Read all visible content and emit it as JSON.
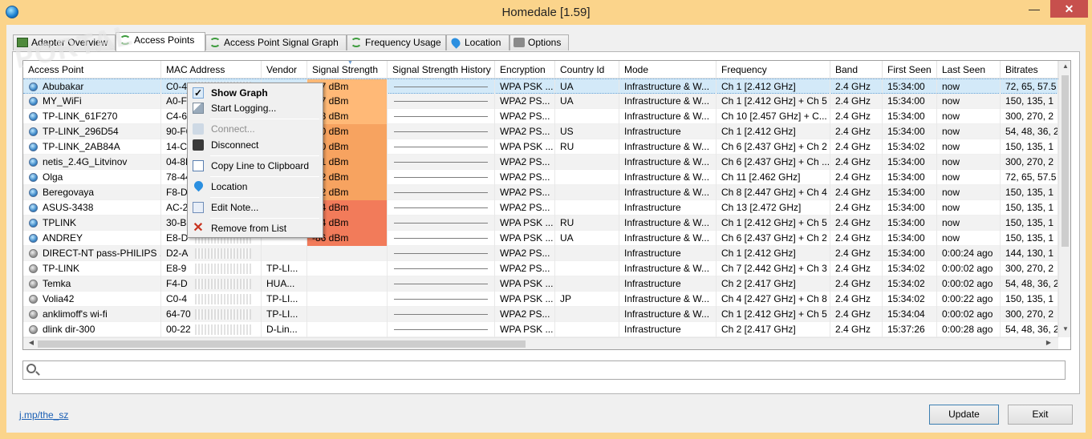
{
  "window": {
    "title": "Homedale [1.59]",
    "minimize": "—",
    "close": "✕"
  },
  "tabs": [
    {
      "label": "Adapter Overview",
      "icon": "adapter-icon"
    },
    {
      "label": "Access Points",
      "icon": "wifi-icon",
      "active": true
    },
    {
      "label": "Access Point Signal Graph",
      "icon": "wifi-icon"
    },
    {
      "label": "Frequency Usage",
      "icon": "wifi-icon"
    },
    {
      "label": "Location",
      "icon": "location-pin-icon"
    },
    {
      "label": "Options",
      "icon": "options-icon"
    }
  ],
  "columns": [
    "Access Point",
    "MAC Address",
    "Vendor",
    "Signal Strength",
    "Signal Strength History",
    "Encryption",
    "Country Id",
    "Mode",
    "Frequency",
    "Band",
    "First Seen",
    "Last Seen",
    "Bitrates"
  ],
  "rows": [
    {
      "ap": "Abubakar",
      "mac": "C0-4",
      "vendor": "",
      "signal": "-77 dBm",
      "enc": "WPA PSK ...",
      "country": "UA",
      "mode": "Infrastructure & W...",
      "freq": "Ch 1 [2.412 GHz]",
      "band": "2.4 GHz",
      "first": "15:34:00",
      "last": "now",
      "bitrates": "72, 65, 57.5"
    },
    {
      "ap": "MY_WiFi",
      "mac": "A0-F",
      "vendor": "",
      "signal": "-77 dBm",
      "enc": "WPA2 PS...",
      "country": "UA",
      "mode": "Infrastructure & W...",
      "freq": "Ch 1 [2.412 GHz] + Ch 5",
      "band": "2.4 GHz",
      "first": "15:34:00",
      "last": "now",
      "bitrates": "150, 135, 1"
    },
    {
      "ap": "TP-LINK_61F270",
      "mac": "C4-6",
      "vendor": "",
      "signal": "-78 dBm",
      "enc": "WPA2 PS...",
      "country": "",
      "mode": "Infrastructure & W...",
      "freq": "Ch 10 [2.457 GHz] + C...",
      "band": "2.4 GHz",
      "first": "15:34:00",
      "last": "now",
      "bitrates": "300, 270, 2"
    },
    {
      "ap": "TP-LINK_296D54",
      "mac": "90-F6",
      "vendor": "",
      "signal": "-80 dBm",
      "enc": "WPA2 PS...",
      "country": "US",
      "mode": "Infrastructure",
      "freq": "Ch 1 [2.412 GHz]",
      "band": "2.4 GHz",
      "first": "15:34:00",
      "last": "now",
      "bitrates": "54, 48, 36, 2"
    },
    {
      "ap": "TP-LINK_2AB84A",
      "mac": "14-C",
      "vendor": "",
      "signal": "-80 dBm",
      "enc": "WPA PSK ...",
      "country": "RU",
      "mode": "Infrastructure & W...",
      "freq": "Ch 6 [2.437 GHz] + Ch 2",
      "band": "2.4 GHz",
      "first": "15:34:02",
      "last": "now",
      "bitrates": "150, 135, 1"
    },
    {
      "ap": "netis_2.4G_Litvinov",
      "mac": "04-8D",
      "vendor": "",
      "signal": "-81 dBm",
      "enc": "WPA2 PS...",
      "country": "",
      "mode": "Infrastructure & W...",
      "freq": "Ch 6 [2.437 GHz] + Ch ...",
      "band": "2.4 GHz",
      "first": "15:34:00",
      "last": "now",
      "bitrates": "300, 270, 2"
    },
    {
      "ap": "Olga",
      "mac": "78-44",
      "vendor": "",
      "signal": "-82 dBm",
      "enc": "WPA2 PS...",
      "country": "",
      "mode": "Infrastructure & W...",
      "freq": "Ch 11 [2.462 GHz]",
      "band": "2.4 GHz",
      "first": "15:34:00",
      "last": "now",
      "bitrates": "72, 65, 57.5"
    },
    {
      "ap": "Beregovaya",
      "mac": "F8-D",
      "vendor": "",
      "signal": "-82 dBm",
      "enc": "WPA2 PS...",
      "country": "",
      "mode": "Infrastructure & W...",
      "freq": "Ch 8 [2.447 GHz] + Ch 4",
      "band": "2.4 GHz",
      "first": "15:34:00",
      "last": "now",
      "bitrates": "150, 135, 1"
    },
    {
      "ap": "ASUS-3438",
      "mac": "AC-2",
      "vendor": "",
      "signal": "-84 dBm",
      "enc": "WPA2 PS...",
      "country": "",
      "mode": "Infrastructure",
      "freq": "Ch 13 [2.472 GHz]",
      "band": "2.4 GHz",
      "first": "15:34:00",
      "last": "now",
      "bitrates": "150, 135, 1"
    },
    {
      "ap": "TPLINK",
      "mac": "30-B5",
      "vendor": "",
      "signal": "-84 dBm",
      "enc": "WPA PSK ...",
      "country": "RU",
      "mode": "Infrastructure & W...",
      "freq": "Ch 1 [2.412 GHz] + Ch 5",
      "band": "2.4 GHz",
      "first": "15:34:00",
      "last": "now",
      "bitrates": "150, 135, 1"
    },
    {
      "ap": "ANDREY",
      "mac": "E8-D",
      "vendor": "",
      "signal": "-86 dBm",
      "enc": "WPA PSK ...",
      "country": "UA",
      "mode": "Infrastructure & W...",
      "freq": "Ch 6 [2.437 GHz] + Ch 2",
      "band": "2.4 GHz",
      "first": "15:34:00",
      "last": "now",
      "bitrates": "150, 135, 1"
    },
    {
      "ap": "DIRECT-NT pass-PHILIPS ...",
      "mac": "D2-A",
      "vendor": "",
      "signal": "",
      "enc": "WPA2 PS...",
      "country": "",
      "mode": "Infrastructure",
      "freq": "Ch 1 [2.412 GHz]",
      "band": "2.4 GHz",
      "first": "15:34:00",
      "last": "0:00:24 ago",
      "bitrates": "144, 130, 1"
    },
    {
      "ap": "TP-LINK",
      "mac": "E8-9",
      "vendor": "TP-LI...",
      "signal": "",
      "enc": "WPA2 PS...",
      "country": "",
      "mode": "Infrastructure & W...",
      "freq": "Ch 7 [2.442 GHz] + Ch 3",
      "band": "2.4 GHz",
      "first": "15:34:02",
      "last": "0:00:02 ago",
      "bitrates": "300, 270, 2"
    },
    {
      "ap": "Temka",
      "mac": "F4-D",
      "vendor": "HUA...",
      "signal": "",
      "enc": "WPA PSK ...",
      "country": "",
      "mode": "Infrastructure",
      "freq": "Ch 2 [2.417 GHz]",
      "band": "2.4 GHz",
      "first": "15:34:02",
      "last": "0:00:02 ago",
      "bitrates": "54, 48, 36, 2"
    },
    {
      "ap": "Volia42",
      "mac": "C0-4",
      "vendor": "TP-LI...",
      "signal": "",
      "enc": "WPA PSK ...",
      "country": "JP",
      "mode": "Infrastructure & W...",
      "freq": "Ch 4 [2.427 GHz] + Ch 8",
      "band": "2.4 GHz",
      "first": "15:34:02",
      "last": "0:00:22 ago",
      "bitrates": "150, 135, 1"
    },
    {
      "ap": "anklimoff's wi-fi",
      "mac": "64-70",
      "vendor": "TP-LI...",
      "signal": "",
      "enc": "WPA2 PS...",
      "country": "",
      "mode": "Infrastructure & W...",
      "freq": "Ch 1 [2.412 GHz] + Ch 5",
      "band": "2.4 GHz",
      "first": "15:34:04",
      "last": "0:00:02 ago",
      "bitrates": "300, 270, 2"
    },
    {
      "ap": "dlink dir-300",
      "mac": "00-22",
      "vendor": "D-Lin...",
      "signal": "",
      "enc": "WPA PSK ...",
      "country": "",
      "mode": "Infrastructure",
      "freq": "Ch 2 [2.417 GHz]",
      "band": "2.4 GHz",
      "first": "15:37:26",
      "last": "0:00:28 ago",
      "bitrates": "54, 48, 36, 2"
    }
  ],
  "context_menu": {
    "show_graph": "Show Graph",
    "start_logging": "Start Logging...",
    "connect": "Connect...",
    "disconnect": "Disconnect",
    "copy_line": "Copy Line to Clipboard",
    "location": "Location",
    "edit_note": "Edit Note...",
    "remove": "Remove from List"
  },
  "search": {
    "value": "",
    "placeholder": ""
  },
  "footer": {
    "link": "j.mp/the_sz",
    "update": "Update",
    "exit": "Exit"
  },
  "watermark": "PORTAL"
}
